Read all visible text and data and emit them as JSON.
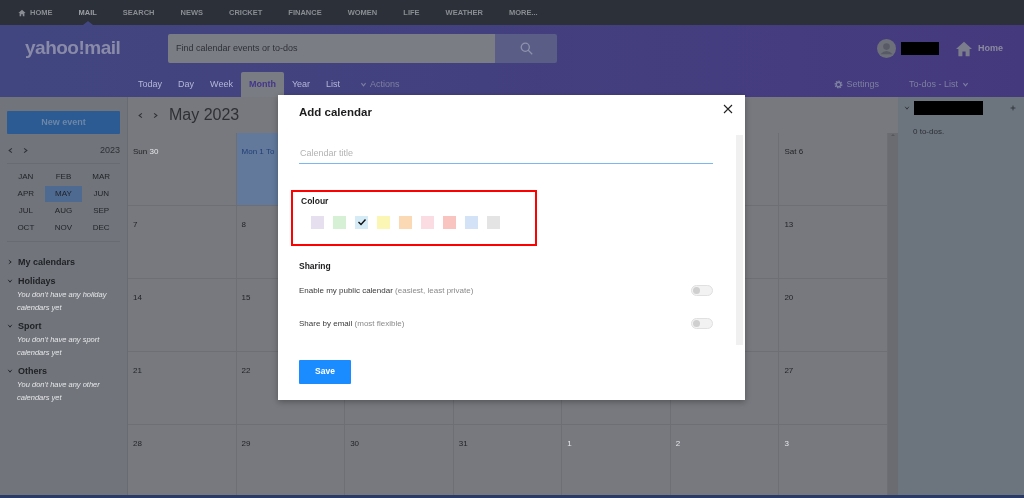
{
  "top_nav": {
    "items": [
      {
        "label": "HOME",
        "selected": false
      },
      {
        "label": "MAIL",
        "selected": true
      },
      {
        "label": "SEARCH",
        "selected": false
      },
      {
        "label": "NEWS",
        "selected": false
      },
      {
        "label": "CRICKET",
        "selected": false
      },
      {
        "label": "FINANCE",
        "selected": false
      },
      {
        "label": "WOMEN",
        "selected": false
      },
      {
        "label": "LIFE",
        "selected": false
      },
      {
        "label": "WEATHER",
        "selected": false
      },
      {
        "label": "MORE...",
        "selected": false
      }
    ]
  },
  "header": {
    "logo": "yahoo!mail",
    "search_placeholder": "Find calendar events or to-dos",
    "home_link": "Home"
  },
  "view_bar": {
    "tabs": [
      {
        "label": "Today",
        "selected": false
      },
      {
        "label": "Day",
        "selected": false
      },
      {
        "label": "Week",
        "selected": false
      },
      {
        "label": "Month",
        "selected": true
      },
      {
        "label": "Year",
        "selected": false
      },
      {
        "label": "List",
        "selected": false
      }
    ],
    "actions": "Actions",
    "settings": "Settings",
    "todos_view": "To-dos - List"
  },
  "sidebar": {
    "new_event": "New event",
    "year": "2023",
    "months": [
      {
        "label": "JAN",
        "selected": false
      },
      {
        "label": "FEB",
        "selected": false
      },
      {
        "label": "MAR",
        "selected": false
      },
      {
        "label": "APR",
        "selected": false
      },
      {
        "label": "MAY",
        "selected": true
      },
      {
        "label": "JUN",
        "selected": false
      },
      {
        "label": "JUL",
        "selected": false
      },
      {
        "label": "AUG",
        "selected": false
      },
      {
        "label": "SEP",
        "selected": false
      },
      {
        "label": "OCT",
        "selected": false
      },
      {
        "label": "NOV",
        "selected": false
      },
      {
        "label": "DEC",
        "selected": false
      }
    ],
    "groups": [
      {
        "name": "My calendars",
        "expanded": false
      },
      {
        "name": "Holidays",
        "expanded": true,
        "note": "You don't have any holiday calendars yet"
      },
      {
        "name": "Sport",
        "expanded": true,
        "note": "You don't have any sport calendars yet"
      },
      {
        "name": "Others",
        "expanded": true,
        "note": "You don't have any other calendars yet"
      }
    ]
  },
  "calendar": {
    "title": "May 2023",
    "weeks": [
      {
        "sun": {
          "day": "Sun",
          "date": "30",
          "muted": true,
          "today": false
        },
        "mon": {
          "day": "Mon",
          "date": "1 To",
          "muted": false,
          "today": true
        },
        "sat": {
          "day": "Sat",
          "date": "6",
          "muted": false,
          "today": false
        }
      },
      {
        "sun": {
          "date": "7",
          "muted": false,
          "today": false
        },
        "mon": {
          "date": "8",
          "muted": false,
          "today": false
        },
        "sat": {
          "date": "13",
          "muted": false,
          "today": false
        }
      },
      {
        "sun": {
          "date": "14",
          "muted": false,
          "today": false
        },
        "mon": {
          "date": "15",
          "muted": false,
          "today": false
        },
        "sat": {
          "date": "20",
          "muted": false,
          "today": false
        }
      },
      {
        "sun": {
          "date": "21",
          "muted": false,
          "today": false
        },
        "mon": {
          "date": "22",
          "muted": false,
          "today": false
        },
        "sat": {
          "date": "27",
          "muted": false,
          "today": false
        }
      },
      {
        "sun": {
          "date": "28",
          "muted": false,
          "today": false
        },
        "mon": {
          "date": "29",
          "muted": false,
          "today": false
        },
        "tue": {
          "date": "30",
          "muted": false,
          "today": false
        },
        "wed": {
          "date": "31",
          "muted": false,
          "today": false
        },
        "thu": {
          "date": "1",
          "muted": true,
          "today": false
        },
        "fri": {
          "date": "2",
          "muted": true,
          "today": false
        },
        "sat": {
          "date": "3",
          "muted": true,
          "today": false
        }
      }
    ]
  },
  "todos": {
    "count": "0 to-dos."
  },
  "dialog": {
    "title": "Add calendar",
    "title_placeholder": "Calendar title",
    "colour_label": "Colour",
    "colour_highlighted": true,
    "colours": [
      {
        "color": "#e6dff0",
        "selected": false
      },
      {
        "color": "#d5f0d5",
        "selected": false
      },
      {
        "color": "#d5ecf7",
        "selected": true
      },
      {
        "color": "#fcf6b5",
        "selected": false
      },
      {
        "color": "#fbd9b5",
        "selected": false
      },
      {
        "color": "#fbdce2",
        "selected": false
      },
      {
        "color": "#f9c4c0",
        "selected": false
      },
      {
        "color": "#d4e2f8",
        "selected": false
      },
      {
        "color": "#e4e4e4",
        "selected": false
      }
    ],
    "sharing_label": "Sharing",
    "sharing": [
      {
        "label": "Enable my public calendar",
        "hint": "(easiest, least private)",
        "on": false
      },
      {
        "label": "Share by email",
        "hint": "(most flexible)",
        "on": false
      }
    ],
    "save": "Save"
  }
}
